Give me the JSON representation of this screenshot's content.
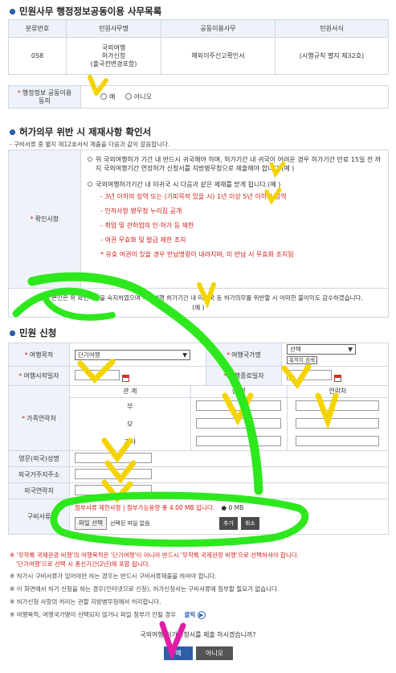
{
  "section1": {
    "title": "민원사무 행정정보공동이용 사무목록",
    "headers": [
      "분류번호",
      "민원사무명",
      "공동이용사무",
      "민원서식"
    ],
    "row": {
      "code": "058",
      "name_lines": [
        "국외여행",
        "허가신청",
        "(출국전변경포함)"
      ],
      "shared": "해외이주신고확인서",
      "form": "(시행규칙 별지 제32호)"
    },
    "consent_label_lines": [
      "행정정보 공동이용",
      "동의"
    ],
    "consent_yes": "예",
    "consent_no": "아니오"
  },
  "section2": {
    "title": "허가의무 위반 시 제재사항 확인서",
    "subtitle": "- 구비서류 중 별지 제12호서식 제출을 다음과 같이 갈음합니다.",
    "label": "확인사항",
    "item1_lines": [
      "위 국외여행허가 기간 내 반드시 귀국해야 하며, 허가기간 내 귀국이 어려운 경우 허가기간 만료 15일 전 까",
      "지 국외여행기간 연장허가 신청서를 지방병무청으로 제출해야 합니다.(예 )"
    ],
    "item2": "국외여행허가기간 내 미귀국 시 다음과 같은 제재를 받게 됩니다.(예 )",
    "penalties": [
      "3년 이하의 징역 또는 (기피목적 있을 시) 1년 이상 5년 이하의 징역",
      "인적사항 병무청 누리집 공개",
      "취업 및 관허업의 인·허가 등 제한",
      "여권 무효화 및 발급 제한 조치",
      "유효 여권이 있을 경우 반납명령이 내려지며, 미 반납 시 무효화 조치됨"
    ],
    "agreement_lines": [
      "상기 본인은 위 확인사항을 숙지하였으며 국외여행 허가기간 내 미귀국 등 허가의무를 위반할 시 어떠한 불이익도 감수하겠습니다.",
      "(예 )"
    ]
  },
  "section3": {
    "title": "민원 신청",
    "purpose_label": "여행목적",
    "purpose_value": "단기여행",
    "country_label": "여행국가명",
    "country_value": "선택",
    "country_button": "목적지 검색",
    "start_label": "여행시작일자",
    "end_label": "여행종료일자",
    "family_label": "가족연락처",
    "family_headers": [
      "관 계",
      "성 명",
      "연락처"
    ],
    "family_rows": [
      "부",
      "모",
      "기타"
    ],
    "english_name_label": "영문(외국)성명",
    "foreign_address_label": "외국거주지주소",
    "foreign_phone_label": "외국연락처",
    "docs_label": "구비서류",
    "docs_limit": "첨부서류 제한사항 | 첨부가능용량 총 4.00 MB 입니다.",
    "docs_used": "0 MB",
    "file_button": "파일 선택",
    "file_status": "선택된 파일 없음",
    "add_button": "추가",
    "cancel_button": "취소"
  },
  "warnings": {
    "line1": "※ '무착륙 국제관광 비행'의 여행목적은 '단기여행'이 아니라 반드시 '무착륙 국제관광 비행'으로 선택하셔야 합니다.",
    "line2": "'단기여행'으로 선택 시 총신기간(2년)에 포함 됩니다."
  },
  "notes": [
    "※ 허가시 구비서류가 있어야만 하는 경우는 반드시 구비서류제출을 하여야 합니다.",
    "※ 이 화면에서 허가 신청을 하는 경우(인터넷으로 신청), 허가신청서는 구비서류에 첨부할 필요가 없습니다.",
    "※ 허가신청 사항의 처리는 관할 지방병무청에서 처리합니다.",
    "※ 여행목적, 여행국가명이 선택되지 않거나 파일 첨부가 안될 경우"
  ],
  "click_link": "클릭",
  "final_question": "국외여행 허가신청서를 제출 하시겠습니까?",
  "submit_yes": "예",
  "submit_no": "아니오"
}
